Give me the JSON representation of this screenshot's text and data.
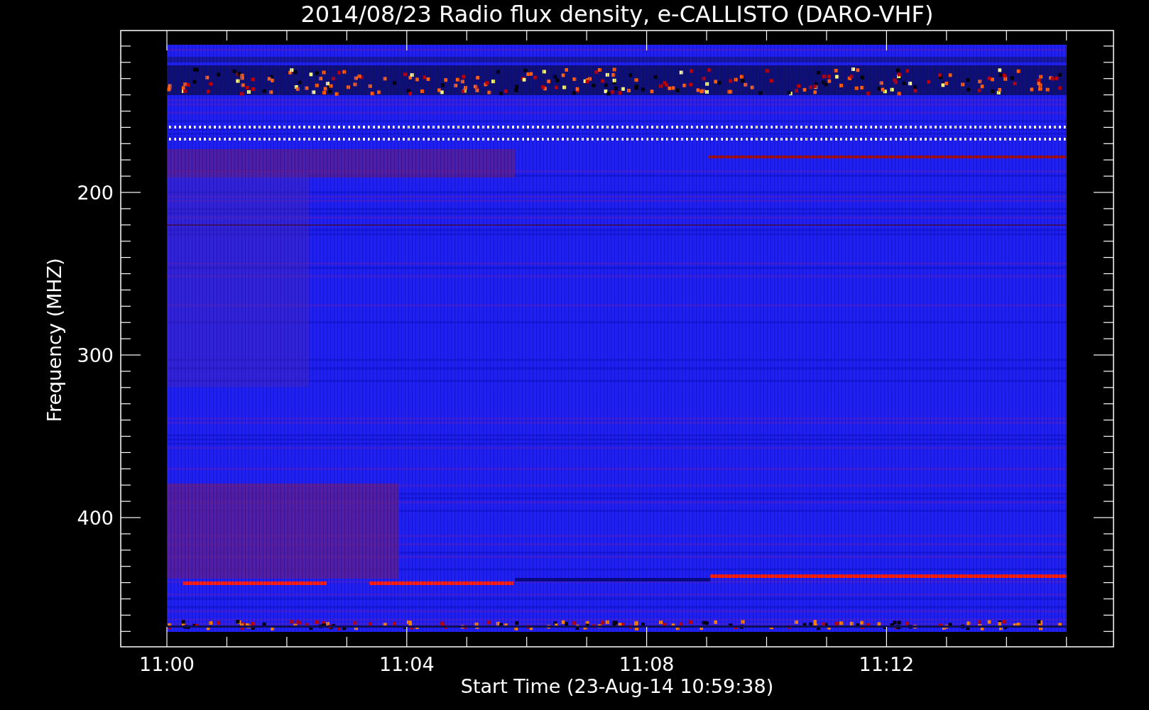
{
  "title": "2014/08/23  Radio flux density, e-CALLISTO (DARO-VHF)",
  "ylabel": "Frequency (MHZ)",
  "xlabel": "Start Time (23-Aug-14 10:59:38)",
  "yticks": [
    "200",
    "300",
    "400"
  ],
  "xticks": [
    "11:00",
    "11:04",
    "11:08",
    "11:12"
  ]
}
